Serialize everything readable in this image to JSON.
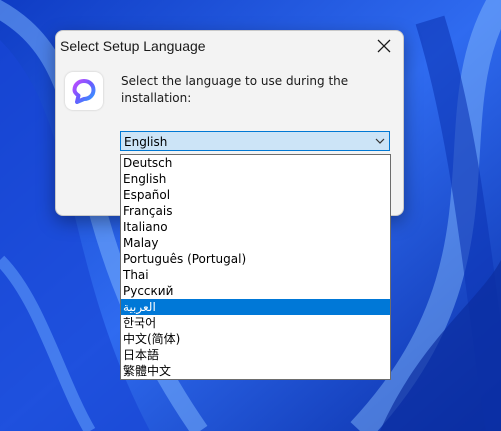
{
  "dialog": {
    "title": "Select Setup Language",
    "prompt": "Select the language to use during the installation:",
    "selected_language": "English"
  },
  "dropdown": {
    "options": [
      "Deutsch",
      "English",
      "Español",
      "Français",
      "Italiano",
      "Malay",
      "Português (Portugal)",
      "Thai",
      "Русский",
      "العربية",
      "한국어",
      "中文(简体)",
      "日本語",
      "繁體中文"
    ],
    "highlighted_option": "العربية"
  },
  "colors": {
    "accent": "#0078d7",
    "selection_bg": "#cce4f7",
    "wallpaper_base": "#1f4fd8"
  },
  "icons": {
    "close": "close-icon",
    "app": "app-logo-icon",
    "chevron": "chevron-down-icon"
  }
}
